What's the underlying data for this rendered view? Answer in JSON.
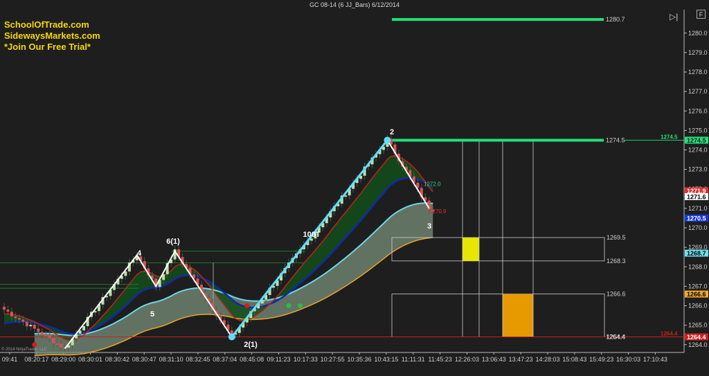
{
  "window": {
    "title": "GC 08-14 (6 JJ_Bars)  6/12/2014",
    "corner_button": "F"
  },
  "promo": {
    "line1": "SchoolOfTrade.com",
    "line2": "SidewaysMarkets.com",
    "line3": "*Join Our Free Trial*"
  },
  "copyright": "© 2014 NinjaTrader, LLC",
  "colors": {
    "background": "#1e1e1e",
    "up_bar": "#b8e0a8",
    "down_bar": "#e05050",
    "resistance": "#22e07a",
    "support": "#cc1f1f",
    "zone_yellow": "#e6e600",
    "zone_orange": "#e69a00",
    "trend_line": "#60dcff",
    "ema_fast": "#c02418",
    "ema_slow": "#0f2aa8",
    "band_upper": "#6fd6e8",
    "band_lower": "#e8a32a"
  },
  "chart_data": {
    "type": "candlestick",
    "ylim": [
      1263.6,
      1281.2
    ],
    "y_ticks": [
      1264.0,
      1265.0,
      1266.0,
      1267.0,
      1268.0,
      1269.0,
      1270.0,
      1271.0,
      1272.0,
      1273.0,
      1274.0,
      1275.0,
      1276.0,
      1277.0,
      1278.0,
      1279.0,
      1280.0
    ],
    "x_labels": [
      "09:41",
      "08:20:17",
      "08:29:00",
      "08:30:01",
      "08:30:42",
      "08:30:47",
      "08:31:10",
      "08:32:45",
      "08:37:04",
      "08:45:08",
      "09:11:23",
      "10:17:33",
      "10:27:55",
      "10:35:36",
      "10:43:15",
      "11:11:31",
      "11:45:23",
      "12:26:03",
      "13:06:43",
      "13:47:23",
      "14:28:03",
      "15:08:43",
      "15:49:23",
      "16:30:03",
      "17:10:43"
    ],
    "price_markers": [
      {
        "label": "1274.5",
        "value": 1274.5,
        "color": "#22e07a",
        "text": "#1e1e1e"
      },
      {
        "label": "1271.9",
        "value": 1271.9,
        "color": "#e03030",
        "text": "#ffffff"
      },
      {
        "label": "1271.6",
        "value": 1271.6,
        "color": "#ffffff",
        "text": "#000000"
      },
      {
        "label": "1270.5",
        "value": 1270.5,
        "color": "#1838e0",
        "text": "#ffffff"
      },
      {
        "label": "1268.7",
        "value": 1268.7,
        "color": "#6fe0ec",
        "text": "#000000"
      },
      {
        "label": "1266.6",
        "value": 1266.6,
        "color": "#f0a830",
        "text": "#000000"
      },
      {
        "label": "1264.4",
        "value": 1264.4,
        "color": "#cc1f1f",
        "text": "#ffffff"
      }
    ],
    "levels": [
      {
        "label": "1280.7",
        "value": 1280.7
      },
      {
        "label": "1274.5",
        "value": 1274.5
      },
      {
        "label": "1264.4",
        "value": 1264.4
      }
    ],
    "zones": [
      {
        "top": 1269.5,
        "bottom": 1268.3,
        "top_label": "1269.5",
        "bottom_label": "1268.3"
      },
      {
        "top": 1266.6,
        "bottom": 1264.4,
        "top_label": "1266.6",
        "bottom_label": "1264.4"
      }
    ],
    "inline_prices": {
      "above": "1272.0",
      "below": "1270.9"
    },
    "wave_labels": [
      "4",
      "5",
      "6(1)",
      "2(1)",
      "2",
      "3",
      "100T"
    ],
    "wave_points": [
      {
        "bar": 16,
        "price": 1263.8
      },
      {
        "bar": 35,
        "price": 1268.6
      },
      {
        "bar": 40,
        "price": 1267.0
      },
      {
        "bar": 45,
        "price": 1268.8
      },
      {
        "bar": 60,
        "price": 1264.4
      },
      {
        "bar": 101,
        "price": 1274.5
      },
      {
        "bar": 112,
        "price": 1271.0
      }
    ],
    "bar_count": 114
  }
}
